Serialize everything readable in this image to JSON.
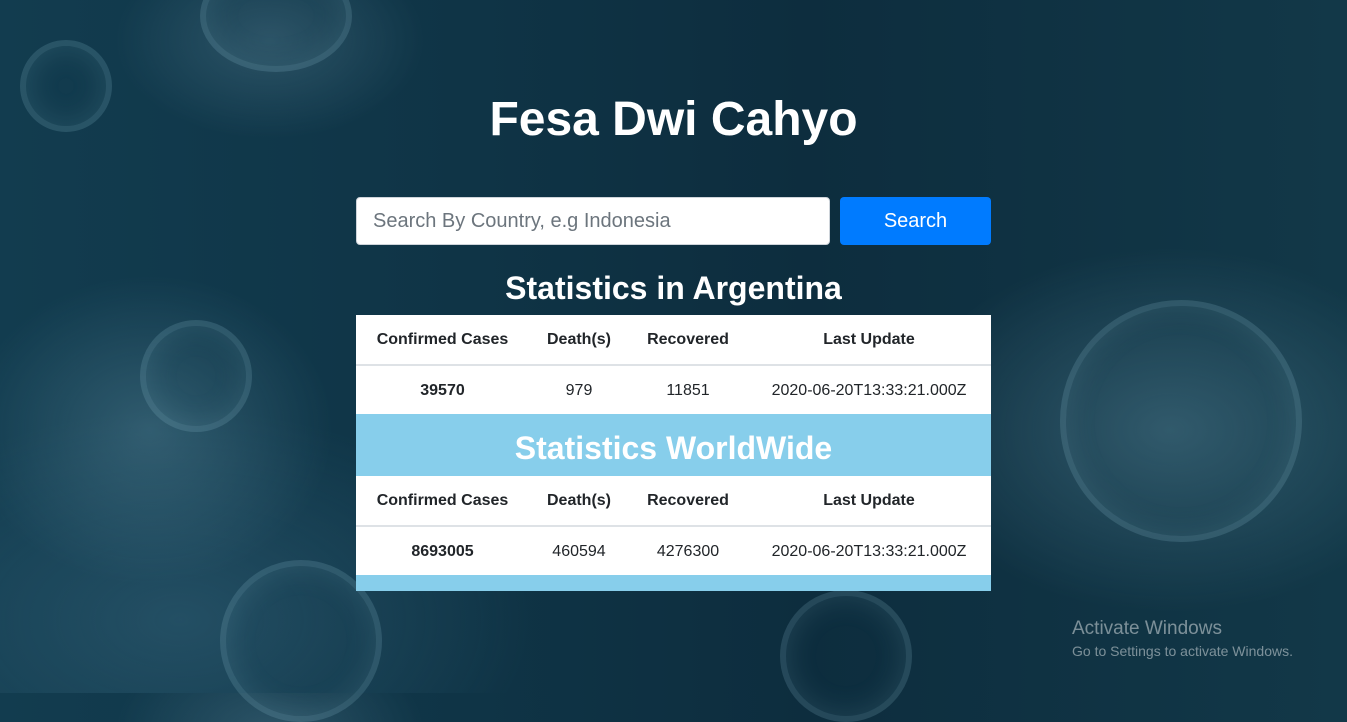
{
  "header": {
    "title": "Fesa Dwi Cahyo"
  },
  "search": {
    "placeholder": "Search By Country, e.g Indonesia",
    "value": "",
    "button_label": "Search",
    "button_color": "#007bff"
  },
  "country_stats": {
    "title": "Statistics in Argentina",
    "columns": [
      "Confirmed Cases",
      "Death(s)",
      "Recovered",
      "Last Update"
    ],
    "row": {
      "confirmed": "39570",
      "deaths": "979",
      "recovered": "11851",
      "last_update": "2020-06-20T13:33:21.000Z"
    }
  },
  "world_stats": {
    "title": "Statistics WorldWide",
    "band_color": "#87ceeb",
    "columns": [
      "Confirmed Cases",
      "Death(s)",
      "Recovered",
      "Last Update"
    ],
    "row": {
      "confirmed": "8693005",
      "deaths": "460594",
      "recovered": "4276300",
      "last_update": "2020-06-20T13:33:21.000Z"
    }
  },
  "os_watermark": {
    "title": "Activate Windows",
    "subtitle": "Go to Settings to activate Windows."
  }
}
